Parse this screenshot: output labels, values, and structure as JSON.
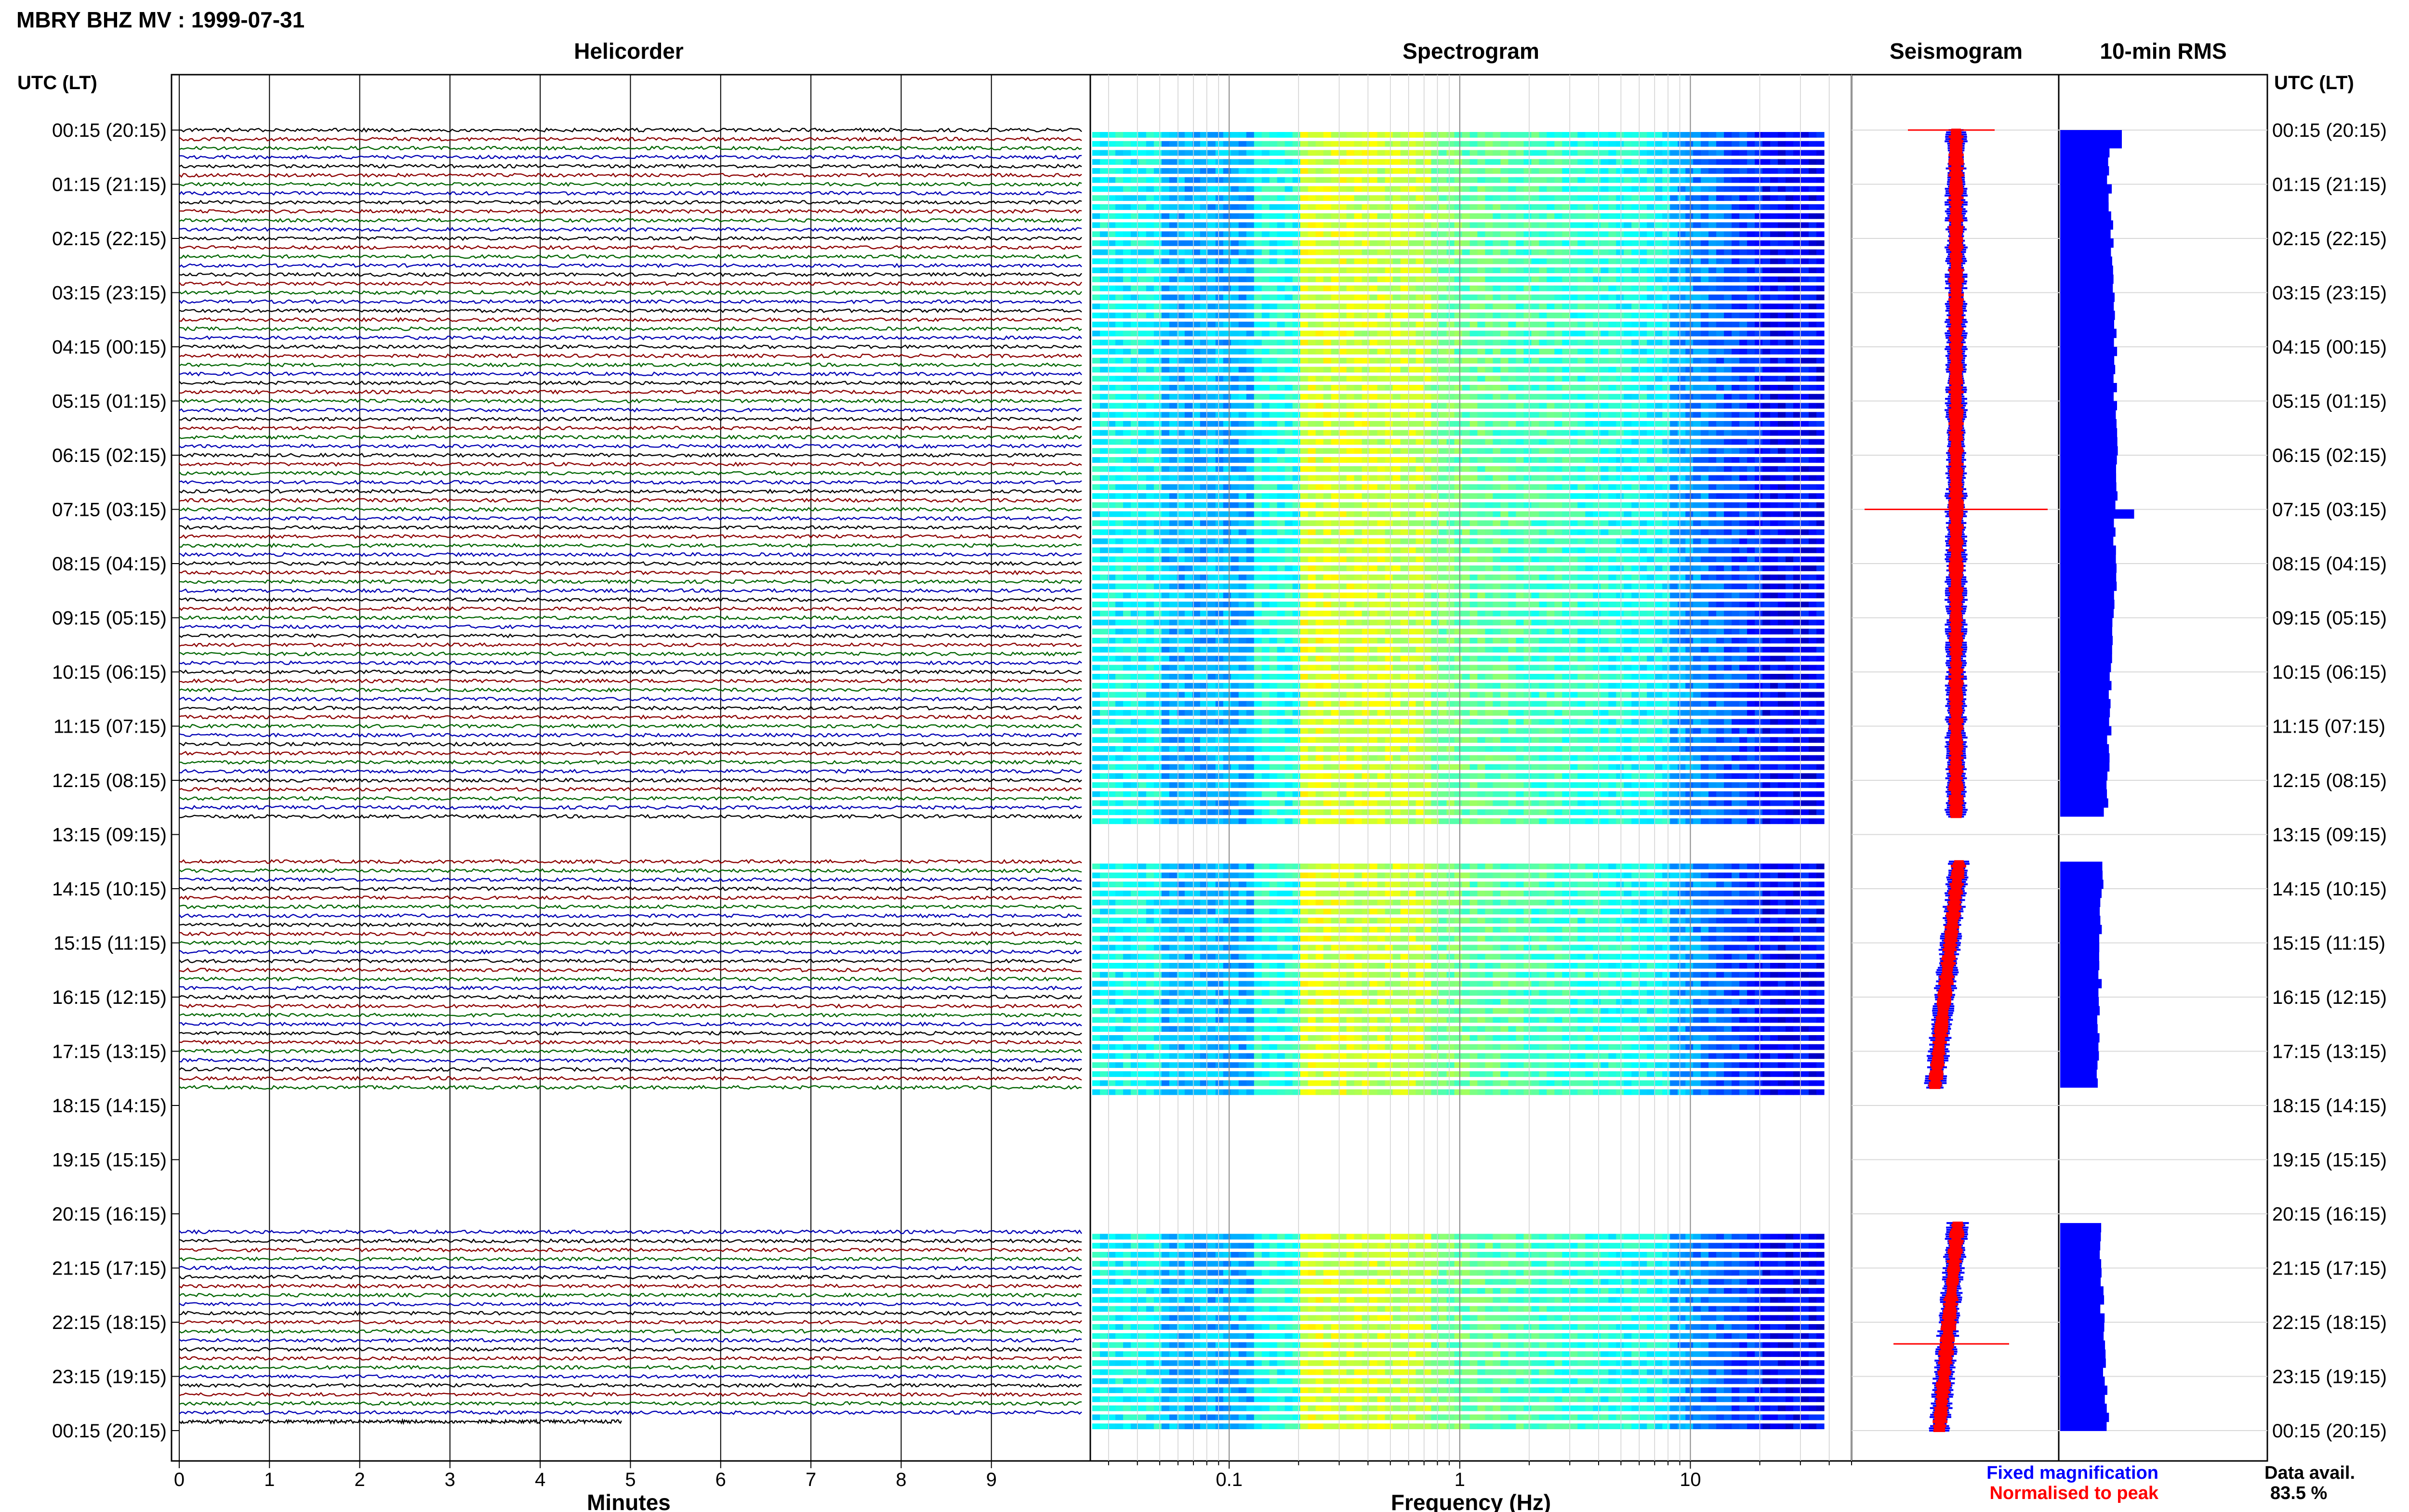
{
  "chart_data": {
    "type": "seismic-dashboard",
    "title": "MBRY BHZ MV : 1999-07-31",
    "time_label": "UTC (LT)",
    "hour_labels": [
      "00:15 (20:15)",
      "01:15 (21:15)",
      "02:15 (22:15)",
      "03:15 (23:15)",
      "04:15 (00:15)",
      "05:15 (01:15)",
      "06:15 (02:15)",
      "07:15 (03:15)",
      "08:15 (04:15)",
      "09:15 (05:15)",
      "10:15 (06:15)",
      "11:15 (07:15)",
      "12:15 (08:15)",
      "13:15 (09:15)",
      "14:15 (10:15)",
      "15:15 (11:15)",
      "16:15 (12:15)",
      "17:15 (13:15)",
      "18:15 (14:15)",
      "19:15 (15:15)",
      "20:15 (16:15)",
      "21:15 (17:15)",
      "22:15 (18:15)",
      "23:15 (19:15)",
      "00:15 (20:15)"
    ],
    "panels": {
      "helicorder": {
        "title": "Helicorder",
        "xlabel": "Minutes",
        "x_ticks": [
          "0",
          "1",
          "2",
          "3",
          "4",
          "5",
          "6",
          "7",
          "8",
          "9"
        ],
        "xlim": [
          0,
          10
        ],
        "trace_colors": [
          "#000000",
          "#8b0000",
          "#006400",
          "#0000b4"
        ]
      },
      "spectrogram": {
        "title": "Spectrogram",
        "xlabel": "Frequency (Hz)",
        "x_ticks": [
          "0.1",
          "1",
          "10"
        ],
        "xlim": [
          0.025,
          50
        ],
        "log_x": true
      },
      "seismogram": {
        "title": "Seismogram",
        "legend": [
          {
            "label": "Fixed magnification",
            "color": "#0000ff"
          },
          {
            "label": "Normalised to peak",
            "color": "#ff0000"
          }
        ]
      },
      "rms": {
        "title": "10-min RMS",
        "color": "#0000ff",
        "data_segments_hours": [
          [
            0.0,
            12.67
          ],
          [
            13.5,
            17.67
          ],
          [
            20.17,
            24.0
          ]
        ]
      }
    },
    "data_availability": {
      "label": "Data avail.",
      "value": "83.5 %",
      "percent": 83.5
    }
  }
}
